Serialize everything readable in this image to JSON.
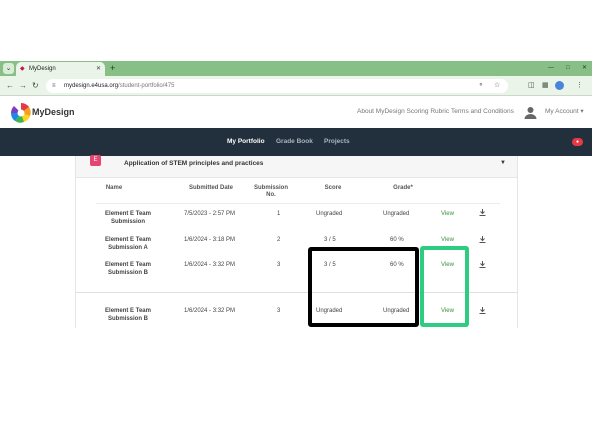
{
  "browser": {
    "tab_title": "MyDesign",
    "url_host": "mydesign.e4usa.org",
    "url_path": "/student-portfolio/475"
  },
  "site": {
    "logo_text": "MyDesign",
    "header_links": [
      "About MyDesign Scoring Rubric",
      "Terms and Conditions"
    ],
    "account_label": "My Account",
    "nav": [
      {
        "label": "My Portfolio",
        "active": true
      },
      {
        "label": "Grade Book",
        "active": false
      },
      {
        "label": "Projects",
        "active": false
      }
    ]
  },
  "section": {
    "badge": "E",
    "title": "Application of STEM principles and practices"
  },
  "table": {
    "headers": [
      "Name",
      "Submitted Date",
      "Submission No.",
      "Score",
      "Grade*"
    ],
    "rows": [
      {
        "name": "Element E Team Submission",
        "date": "7/5/2023 - 2:57 PM",
        "number": "1",
        "score": "Ungraded",
        "grade": "Ungraded",
        "action": "View"
      },
      {
        "name": "Element E Team Submission A",
        "date": "1/6/2024 - 3:18 PM",
        "number": "2",
        "score": "3 / 5",
        "grade": "60 %",
        "action": "View"
      },
      {
        "name": "Element E Team Submission B",
        "date": "1/6/2024 - 3:32 PM",
        "number": "3",
        "score": "3 / 5",
        "grade": "60 %",
        "action": "View"
      },
      {
        "name": "Element E Team Submission B",
        "date": "1/6/2024 - 3:32 PM",
        "number": "3",
        "score": "Ungraded",
        "grade": "Ungraded",
        "action": "View"
      }
    ]
  },
  "colors": {
    "nav_bg": "#22303d",
    "accent_pink": "#e5466f",
    "view_link": "#3a8f3a",
    "highlight_green": "#2ecc80",
    "highlight_black": "#000000"
  }
}
